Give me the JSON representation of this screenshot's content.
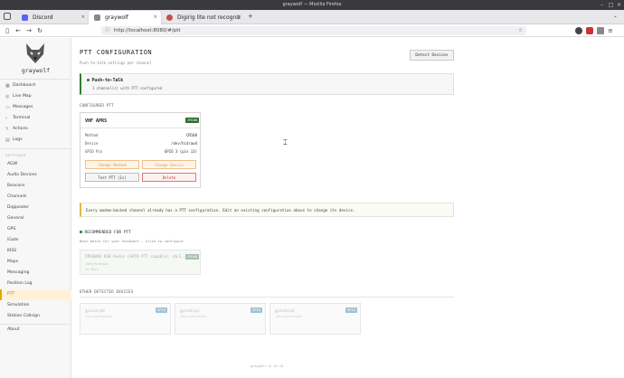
{
  "window": {
    "title": "graywolf — Mozilla Firefox"
  },
  "tabs": [
    {
      "label": "Discord",
      "color": "#5865f2"
    },
    {
      "label": "graywolf",
      "color": "#777777"
    },
    {
      "label": "Digirig lite not recogniz",
      "color": "#c05050"
    }
  ],
  "nav": {
    "url": "http://localhost:8080/#/ptt"
  },
  "sidebar": {
    "brand": "graywolf",
    "items": [
      {
        "label": "Dashboard",
        "icon": "grid-icon"
      },
      {
        "label": "Live Map",
        "icon": "globe-icon"
      },
      {
        "label": "Messages",
        "icon": "message-icon"
      },
      {
        "label": "Terminal",
        "icon": "terminal-icon"
      },
      {
        "label": "Actions",
        "icon": "bolt-icon"
      },
      {
        "label": "Logs",
        "icon": "log-icon"
      }
    ],
    "settings_label": "SETTINGS",
    "settings": [
      "AGW",
      "Audio Devices",
      "Beacons",
      "Channels",
      "Digipeater",
      "General",
      "GPS",
      "iGate",
      "KISS",
      "Maps",
      "Messaging",
      "Position Log",
      "PTT",
      "Simulation",
      "Station Callsign"
    ],
    "active": "PTT",
    "about": "About"
  },
  "page": {
    "title": "PTT CONFIGURATION",
    "subtitle": "Push-to-talk settings per channel",
    "detect_button": "Detect Devices",
    "summary": {
      "title": "Push-to-Talk",
      "detail": "1 channel(s) with PTT configured"
    },
    "configured_label": "CONFIGURED PTT",
    "card": {
      "name": "VHF APRS",
      "badge": "CM108",
      "fields": [
        {
          "k": "Method",
          "v": "CM108"
        },
        {
          "k": "Device",
          "v": "/dev/hidraw4"
        },
        {
          "k": "GPIO Pin",
          "v": "GPIO 3 (pin 13)"
        }
      ],
      "change_method": "Change Method",
      "change_device": "Change Device",
      "test": "Test PTT (1s)",
      "delete": "Delete"
    },
    "notice": "Every modem-backed channel already has a PTT configuration. Edit an existing configuration above to change its device.",
    "recommended": {
      "title": "RECOMMENDED FOR PTT",
      "subtitle": "Best match for your hardware — click to configure",
      "device": {
        "name": "CM108AH USB Audio (GPIO PTT capable) (ALS...",
        "badge": "CM108",
        "line1": "/dev/hidraw4",
        "line2": "12 GB/s"
      }
    },
    "other_label": "OTHER DETECTED DEVICES",
    "others": [
      {
        "name": "gpiochip0",
        "sub": "/dev/gpiochip0",
        "badge": "GPIO"
      },
      {
        "name": "gpiochip1",
        "sub": "/dev/gpiochip1",
        "badge": "GPIO"
      },
      {
        "name": "gpiochip4",
        "sub": "/dev/gpiochip4",
        "badge": "GPIO"
      }
    ],
    "footer": "graywolf 0.13.15"
  }
}
